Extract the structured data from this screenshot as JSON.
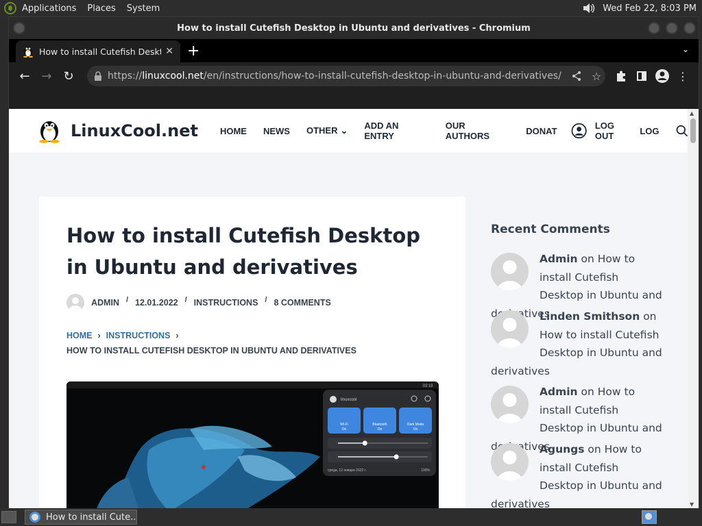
{
  "top_panel": {
    "menus": [
      "Applications",
      "Places",
      "System"
    ],
    "clock": "Wed Feb 22,  8:03 PM"
  },
  "window": {
    "title": "How to install Cutefish Desktop in Ubuntu and derivatives - Chromium"
  },
  "tab": {
    "title": "How to install Cutefish Deskto",
    "close": "✕"
  },
  "toolbar": {
    "url_scheme": "https://",
    "url_host": "linuxcool.net",
    "url_path": "/en/instructions/how-to-install-cutefish-desktop-in-ubuntu-and-derivatives/"
  },
  "site": {
    "name": "LinuxCool.net",
    "nav": [
      "HOME",
      "NEWS",
      "OTHER",
      "ADD AN ENTRY",
      "OUR AUTHORS",
      "DONAT"
    ],
    "nav_other_chevron": "⌄",
    "logout": "LOG OUT",
    "log": "LOG"
  },
  "article": {
    "title": "How to install Cutefish Desktop in Ubuntu and derivatives",
    "author": "ADMIN",
    "date": "12.01.2022",
    "category": "INSTRUCTIONS",
    "comments": "8 COMMENTS",
    "breadcrumb_home": "HOME",
    "breadcrumb_section": "INSTRUCTIONS",
    "breadcrumb_current": "HOW TO INSTALL CUTEFISH DESKTOP IN UBUNTU AND DERIVATIVES",
    "hero": {
      "panel_user": "linuxcool",
      "tiles": [
        {
          "label": "Wi-Fi",
          "state": "On"
        },
        {
          "label": "Bluetooth",
          "state": "On"
        },
        {
          "label": "Dark Mode",
          "state": "On"
        }
      ],
      "date": "среда, 12 января 2022 г.",
      "battery": "100%",
      "clock": "03:19",
      "brightness_level": 0.3,
      "volume_level": 0.65
    }
  },
  "sidebar": {
    "heading": "Recent Comments",
    "on_word": "on",
    "comments": [
      {
        "author": "Admin",
        "post": "How to install Cutefish Desktop in Ubuntu and derivatives"
      },
      {
        "author": "Linden Smithson",
        "post": "How to install Cutefish Desktop in Ubuntu and derivatives"
      },
      {
        "author": "Admin",
        "post": "How to install Cutefish Desktop in Ubuntu and derivatives"
      },
      {
        "author": "Agungs",
        "post": "How to install Cutefish Desktop in Ubuntu and derivatives"
      }
    ]
  },
  "taskbar": {
    "task_title": "How to install Cute..."
  }
}
